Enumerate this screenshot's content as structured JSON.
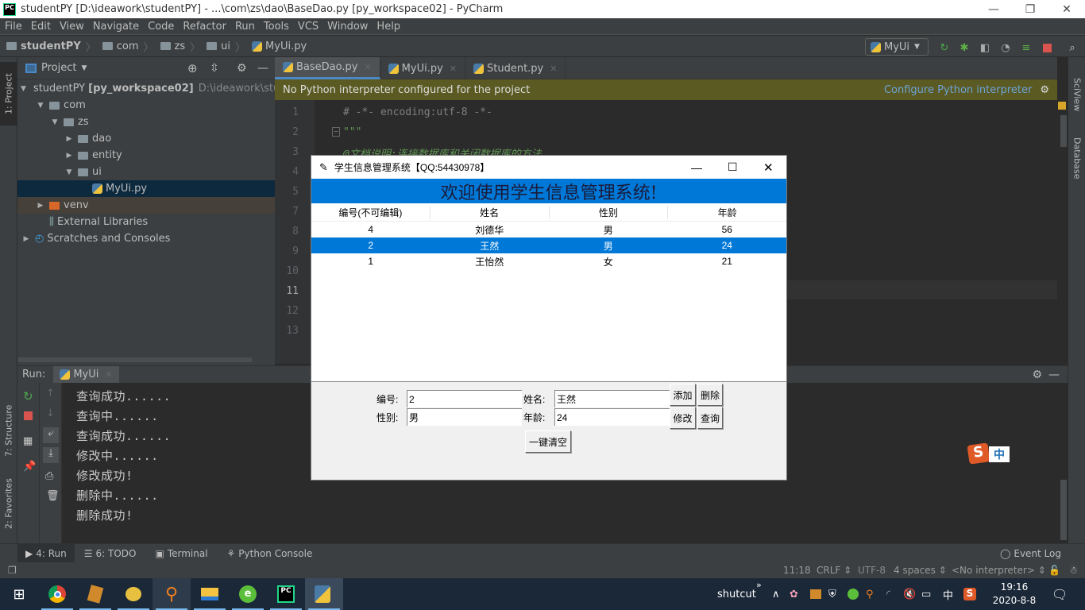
{
  "window": {
    "title": "studentPY [D:\\ideawork\\studentPY] - ...\\com\\zs\\dao\\BaseDao.py [py_workspace02] - PyCharm",
    "app_icon": "PC",
    "controls": {
      "minimize": "—",
      "restore": "❐",
      "close": "✕"
    }
  },
  "menu": [
    "File",
    "Edit",
    "View",
    "Navigate",
    "Code",
    "Refactor",
    "Run",
    "Tools",
    "VCS",
    "Window",
    "Help"
  ],
  "breadcrumb": [
    "studentPY",
    "com",
    "zs",
    "ui",
    "MyUi.py"
  ],
  "toolbar": {
    "run_config": "MyUi"
  },
  "left_stripe": {
    "project": "1: Project",
    "structure": "7: Structure",
    "favorites": "2: Favorites"
  },
  "right_stripe": {
    "sciview": "SciView",
    "database": "Database"
  },
  "project_panel": {
    "title": "Project",
    "tree": [
      {
        "label": "studentPY",
        "bold": "[py_workspace02]",
        "extra": "D:\\ideawork\\stude",
        "level": 0,
        "state": "expanded",
        "icon": "folder"
      },
      {
        "label": "com",
        "level": 1,
        "state": "expanded",
        "icon": "folder"
      },
      {
        "label": "zs",
        "level": 2,
        "state": "expanded",
        "icon": "folder"
      },
      {
        "label": "dao",
        "level": 3,
        "state": "collapsed",
        "icon": "folder"
      },
      {
        "label": "entity",
        "level": 3,
        "state": "collapsed",
        "icon": "folder"
      },
      {
        "label": "ui",
        "level": 3,
        "state": "expanded",
        "icon": "folder"
      },
      {
        "label": "MyUi.py",
        "level": 4,
        "state": "leaf",
        "icon": "python-file",
        "selected": true
      },
      {
        "label": "venv",
        "level": 1,
        "state": "collapsed",
        "icon": "folder-excluded"
      },
      {
        "label": "External Libraries",
        "level": 1,
        "state": "leaf",
        "icon": "library"
      },
      {
        "label": "Scratches and Consoles",
        "level": 0,
        "state": "collapsed",
        "icon": "scratches"
      }
    ]
  },
  "editor": {
    "tabs": [
      {
        "label": "BaseDao.py",
        "active": true
      },
      {
        "label": "MyUi.py",
        "active": false
      },
      {
        "label": "Student.py",
        "active": false
      }
    ],
    "banner": {
      "message": "No Python interpreter configured for the project",
      "action": "Configure Python interpreter"
    },
    "line_numbers": [
      "1",
      "2",
      "3",
      "4",
      "5",
      "7",
      "8",
      "9",
      "10",
      "11",
      "12",
      "13"
    ],
    "code": [
      "# -*- encoding:utf-8 -*-",
      "\"\"\"",
      "@文档说明:连接数据库和关闭数据库的方法"
    ]
  },
  "run_panel": {
    "label": "Run:",
    "tab": "MyUi",
    "output": [
      "查询成功......",
      "查询中......",
      "查询成功......",
      "修改中......",
      "修改成功!",
      "删除中......",
      "删除成功!"
    ]
  },
  "tool_tabs": [
    {
      "label": "4: Run",
      "icon": "run-icon"
    },
    {
      "label": "6: TODO",
      "icon": "todo-icon"
    },
    {
      "label": "Terminal",
      "icon": "terminal-icon"
    },
    {
      "label": "Python Console",
      "icon": "python-console-icon"
    }
  ],
  "event_log": "Event Log",
  "status": {
    "position": "11:18",
    "line_sep": "CRLF ⇕",
    "encoding": "UTF-8",
    "indent": "4 spaces ⇕",
    "interpreter": "<No interpreter> ⇕"
  },
  "tk_app": {
    "title": "学生信息管理系统【QQ:54430978】",
    "banner": "欢迎使用学生信息管理系统!",
    "columns": [
      "编号(不可编辑)",
      "姓名",
      "性别",
      "年龄"
    ],
    "rows": [
      {
        "id": "4",
        "name": "刘德华",
        "gender": "男",
        "age": "56",
        "selected": false
      },
      {
        "id": "2",
        "name": "王然",
        "gender": "男",
        "age": "24",
        "selected": true
      },
      {
        "id": "1",
        "name": "王怡然",
        "gender": "女",
        "age": "21",
        "selected": false
      }
    ],
    "form": {
      "id_label": "编号:",
      "id_value": "2",
      "name_label": "姓名:",
      "name_value": "王然",
      "gender_label": "性别:",
      "gender_value": "男",
      "age_label": "年龄:",
      "age_value": "24"
    },
    "buttons": {
      "add": "添加",
      "delete": "删除",
      "modify": "修改",
      "query": "查询",
      "clear": "一键清空"
    }
  },
  "ime": {
    "mode": "中"
  },
  "taskbar": {
    "apps": [
      "windows-start",
      "chrome",
      "book-app",
      "yellow-app",
      "search-app",
      "file-explorer",
      "green-browser",
      "pycharm",
      "python-tk"
    ],
    "shortcut_label": "shutcut",
    "tray_ime": "中",
    "time": "19:16",
    "date": "2020-8-8"
  }
}
